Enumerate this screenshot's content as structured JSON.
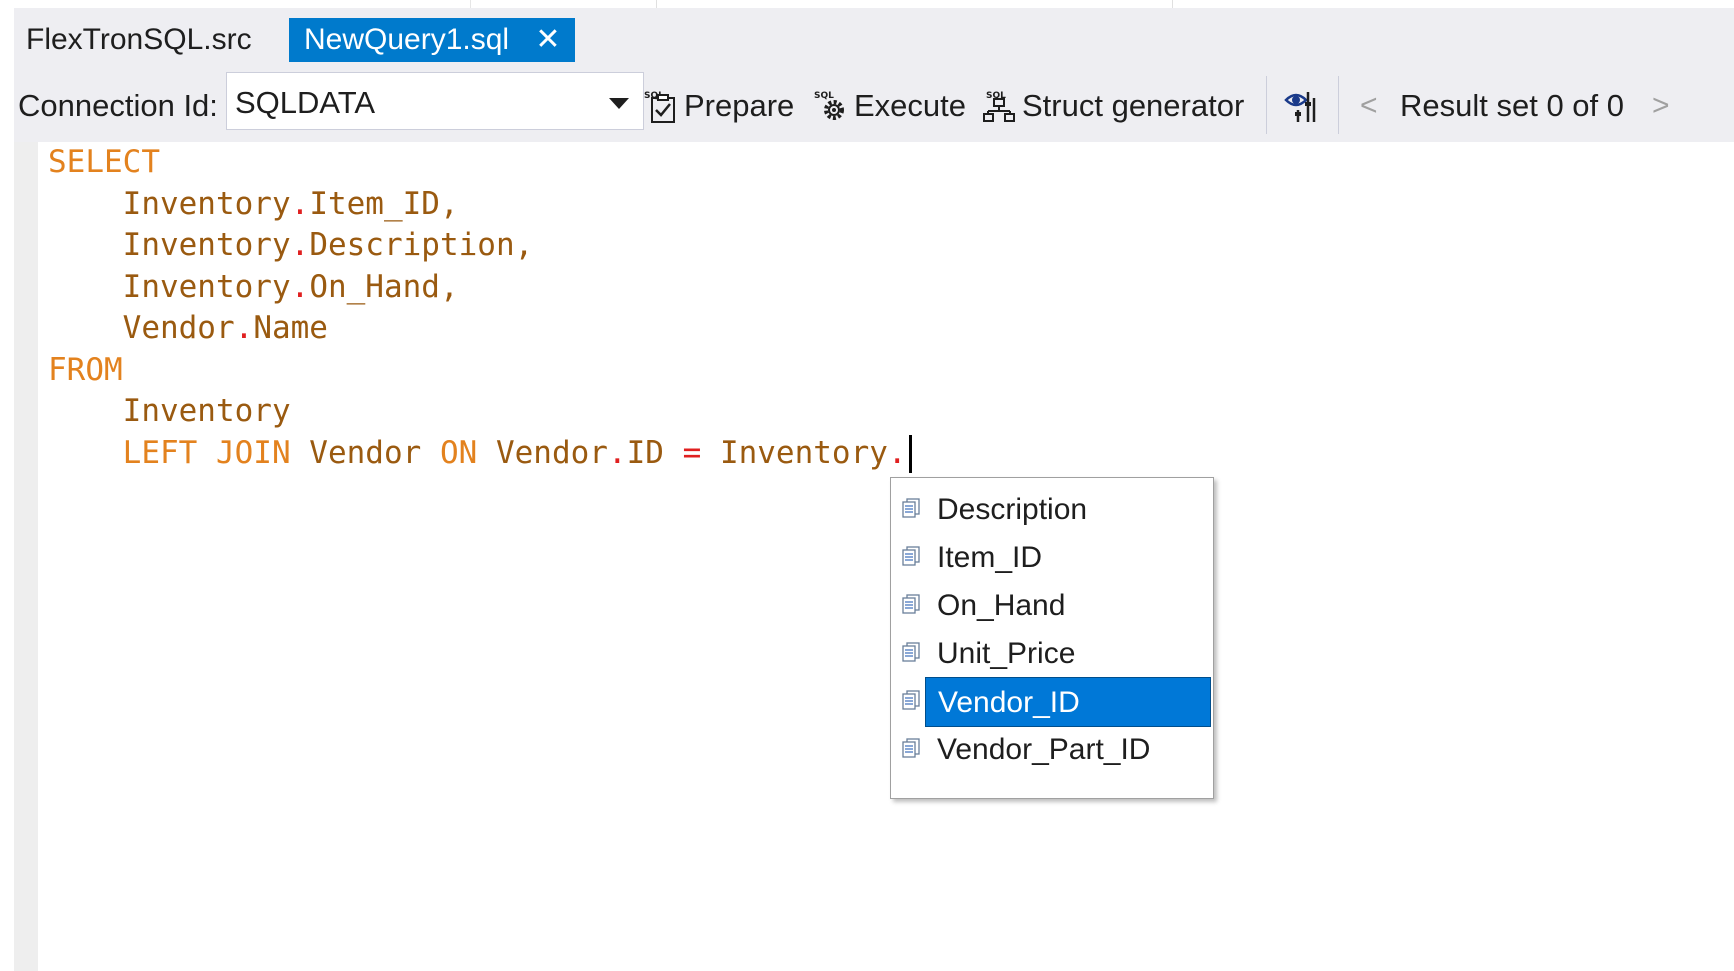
{
  "tabs": [
    {
      "label": "FlexTronSQL.src",
      "active": false
    },
    {
      "label": "NewQuery1.sql",
      "active": true,
      "close_glyph": "✕"
    }
  ],
  "toolbar": {
    "connection_label": "Connection Id:",
    "connection_value": "SQLDATA",
    "prepare_label": "Prepare",
    "execute_label": "Execute",
    "struct_label": "Struct generator",
    "prev_glyph": "<",
    "next_glyph": ">",
    "result_label": "Result set 0 of 0",
    "icons": {
      "prepare": "sql-prepare-icon",
      "execute": "sql-execute-gear-icon",
      "struct": "sql-struct-generator-icon",
      "preview": "eye-settings-icon"
    }
  },
  "editor": {
    "lines": [
      [
        {
          "t": "SELECT",
          "c": "kw"
        }
      ],
      [
        {
          "t": "    Inventory",
          "c": "id"
        },
        {
          "t": ".",
          "c": "op"
        },
        {
          "t": "Item_ID,",
          "c": "id"
        }
      ],
      [
        {
          "t": "    Inventory",
          "c": "id"
        },
        {
          "t": ".",
          "c": "op"
        },
        {
          "t": "Description,",
          "c": "id"
        }
      ],
      [
        {
          "t": "    Inventory",
          "c": "id"
        },
        {
          "t": ".",
          "c": "op"
        },
        {
          "t": "On_Hand,",
          "c": "id"
        }
      ],
      [
        {
          "t": "    Vendor",
          "c": "id"
        },
        {
          "t": ".",
          "c": "op"
        },
        {
          "t": "Name",
          "c": "id"
        }
      ],
      [
        {
          "t": "FROM",
          "c": "kw"
        }
      ],
      [
        {
          "t": "    Inventory",
          "c": "id"
        }
      ],
      [
        {
          "t": "    LEFT JOIN ",
          "c": "kw"
        },
        {
          "t": "Vendor ",
          "c": "id"
        },
        {
          "t": "ON ",
          "c": "kw"
        },
        {
          "t": "Vendor",
          "c": "id"
        },
        {
          "t": ".",
          "c": "op"
        },
        {
          "t": "ID ",
          "c": "id"
        },
        {
          "t": "= ",
          "c": "op"
        },
        {
          "t": "Inventory",
          "c": "id"
        },
        {
          "t": ".",
          "c": "op"
        }
      ]
    ],
    "colors": {
      "keyword": "#e3821e",
      "identifier": "#9a5a10",
      "operator": "#e02020"
    }
  },
  "autocomplete": {
    "items": [
      "Description",
      "Item_ID",
      "On_Hand",
      "Unit_Price",
      "Vendor_ID",
      "Vendor_Part_ID"
    ],
    "selected_index": 4,
    "item_icon": "column-field-icon",
    "selection_color": "#0078d7"
  },
  "colors": {
    "accent": "#007acc",
    "chrome": "#eeeef2"
  }
}
